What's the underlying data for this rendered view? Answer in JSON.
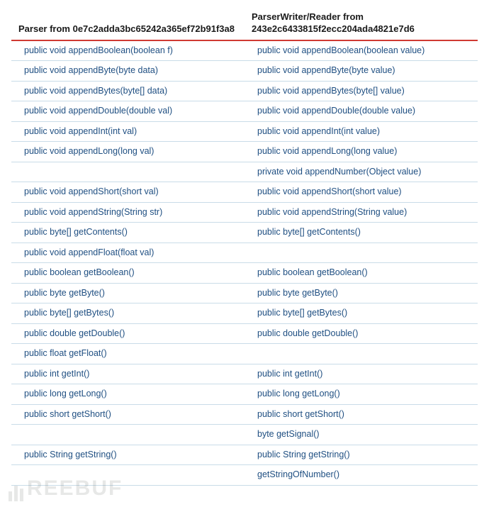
{
  "headers": {
    "left": "Parser from 0e7c2adda3bc65242a365ef72b91f3a8",
    "right": "ParserWriter/Reader from 243e2c6433815f2ecc204ada4821e7d6"
  },
  "rows": [
    {
      "left": "public void appendBoolean(boolean f)",
      "right": "public void appendBoolean(boolean value)"
    },
    {
      "left": "public void appendByte(byte data)",
      "right": "public void appendByte(byte value)"
    },
    {
      "left": "public void appendBytes(byte[] data)",
      "right": "public void appendBytes(byte[] value)"
    },
    {
      "left": "public void appendDouble(double val)",
      "right": "public void appendDouble(double value)"
    },
    {
      "left": "public void appendInt(int val)",
      "right": "public void appendInt(int value)"
    },
    {
      "left": "public void appendLong(long val)",
      "right": "public void appendLong(long value)"
    },
    {
      "left": "",
      "right": "private void appendNumber(Object value)"
    },
    {
      "left": "public void appendShort(short val)",
      "right": "public void appendShort(short value)"
    },
    {
      "left": "public void appendString(String str)",
      "right": "public void appendString(String value)"
    },
    {
      "left": "public byte[] getContents()",
      "right": "public byte[] getContents()"
    },
    {
      "left": "public void appendFloat(float val)",
      "right": ""
    },
    {
      "left": "public boolean getBoolean()",
      "right": "public boolean getBoolean()"
    },
    {
      "left": "public byte getByte()",
      "right": "public byte getByte()"
    },
    {
      "left": "public byte[] getBytes()",
      "right": "public byte[] getBytes()"
    },
    {
      "left": "public double getDouble()",
      "right": "public double getDouble()"
    },
    {
      "left": "public float getFloat()",
      "right": ""
    },
    {
      "left": "public int getInt()",
      "right": "public int getInt()"
    },
    {
      "left": "public long getLong()",
      "right": "public long getLong()"
    },
    {
      "left": "public short getShort()",
      "right": "public short getShort()"
    },
    {
      "left": "",
      "right": "byte getSignal()"
    },
    {
      "left": "public String getString()",
      "right": "public String getString()"
    },
    {
      "left": "",
      "right": "getStringOfNumber()"
    }
  ],
  "watermark": "REEBUF"
}
